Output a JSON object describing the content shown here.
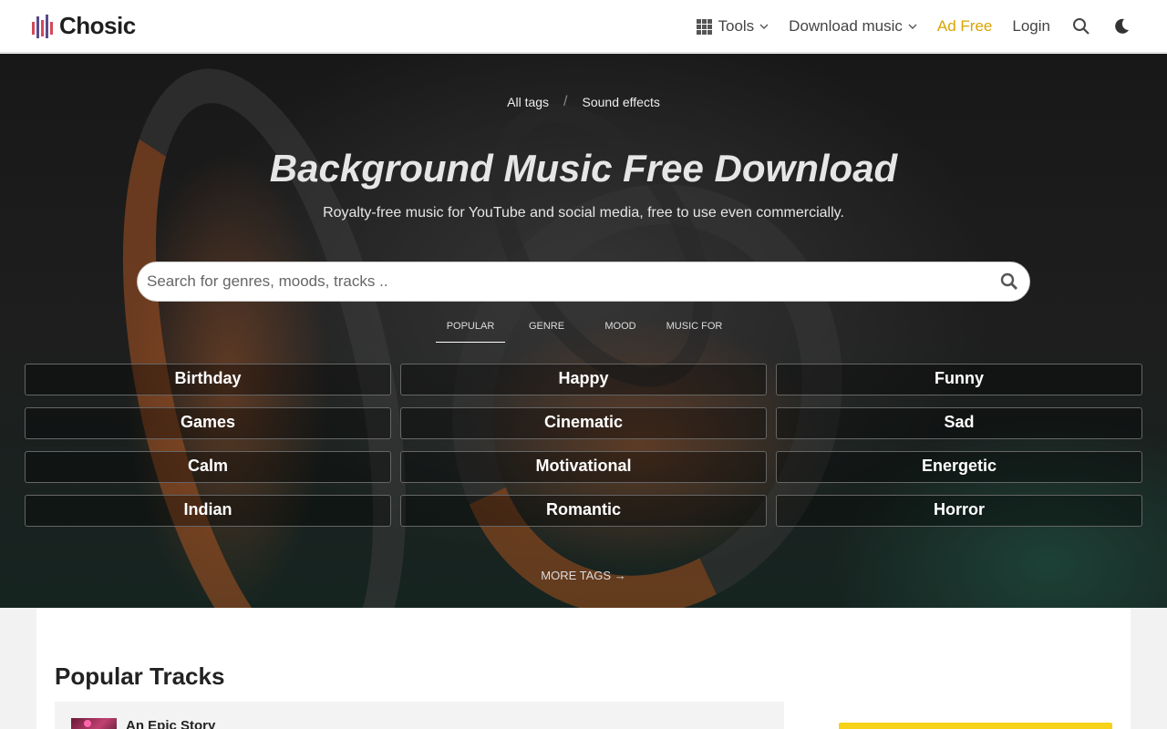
{
  "header": {
    "logo_text": "Chosic",
    "nav": {
      "tools": "Tools",
      "download_music": "Download music",
      "ad_free": "Ad Free",
      "login": "Login"
    },
    "icons": [
      "grid-icon",
      "search-icon",
      "moon-icon"
    ],
    "accent_color": "#d9a400"
  },
  "hero": {
    "breadcrumbs": [
      "All tags",
      "Sound effects"
    ],
    "breadcrumb_separator": "/",
    "title": "Background Music Free Download",
    "subtitle": "Royalty-free music for YouTube and social media, free to use even commercially.",
    "search": {
      "placeholder": "Search for genres, moods, tracks .."
    },
    "tabs": [
      "POPULAR",
      "GENRE",
      "MOOD",
      "MUSIC FOR"
    ],
    "active_tab": "POPULAR",
    "tags": [
      "Birthday",
      "Happy",
      "Funny",
      "Games",
      "Cinematic",
      "Sad",
      "Calm",
      "Motivational",
      "Energetic",
      "Indian",
      "Romantic",
      "Horror"
    ],
    "more_tags": "MORE TAGS →"
  },
  "main": {
    "section_title": "Popular Tracks",
    "tracks": [
      {
        "title": "An Epic Story"
      }
    ]
  }
}
